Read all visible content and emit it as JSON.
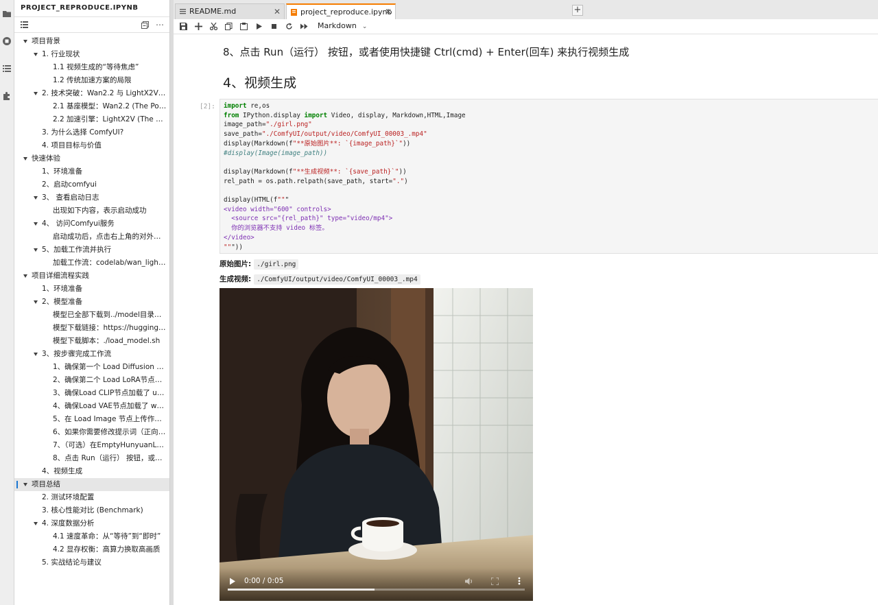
{
  "sidebar": {
    "title": "PROJECT_REPRODUCE.IPYNB",
    "items": [
      {
        "level": 1,
        "label": "项目背景",
        "expanded": true
      },
      {
        "level": 2,
        "label": "1. 行业现状",
        "expanded": true
      },
      {
        "level": 3,
        "label": "1.1 视频生成的“等待焦虑”"
      },
      {
        "level": 3,
        "label": "1.2 传统加速方案的局限"
      },
      {
        "level": 2,
        "label": "2. 技术突破：Wan2.2 与 LightX2V 的...",
        "expanded": true
      },
      {
        "level": 3,
        "label": "2.1 基座模型：Wan2.2 (The Power..."
      },
      {
        "level": 3,
        "label": "2.2 加速引擎：LightX2V (The Spe..."
      },
      {
        "level": 2,
        "label": "3. 为什么选择 ComfyUI?"
      },
      {
        "level": 2,
        "label": "4. 项目目标与价值"
      },
      {
        "level": 1,
        "label": "快速体验",
        "expanded": true
      },
      {
        "level": 2,
        "label": "1、环境准备"
      },
      {
        "level": 2,
        "label": "2、启动comfyui"
      },
      {
        "level": 2,
        "label": "3、 查看启动日志",
        "expanded": true
      },
      {
        "level": 3,
        "label": "出现如下内容，表示启动成功"
      },
      {
        "level": 2,
        "label": "4、 访问Comfyui服务",
        "expanded": true
      },
      {
        "level": 3,
        "label": "启动成功后，点击右上角的对外服务..."
      },
      {
        "level": 2,
        "label": "5、加载工作流并执行",
        "expanded": true
      },
      {
        "level": 3,
        "label": "加载工作流：codelab/wan_lightx2..."
      },
      {
        "level": 1,
        "label": "项目详细流程实践",
        "expanded": true
      },
      {
        "level": 2,
        "label": "1、环境准备"
      },
      {
        "level": 2,
        "label": "2、模型准备",
        "expanded": true
      },
      {
        "level": 3,
        "label": "模型已全部下载到../model目录下，..."
      },
      {
        "level": 3,
        "label": "模型下载链接：https://huggingfac..."
      },
      {
        "level": 3,
        "label": "模型下载脚本：./load_model.sh"
      },
      {
        "level": 2,
        "label": "3、按步骤完成工作流",
        "expanded": true
      },
      {
        "level": 3,
        "label": "1、确保第一个 Load Diffusion Mo..."
      },
      {
        "level": 3,
        "label": "2、确保第二个 Load LoRA节点加载..."
      },
      {
        "level": 3,
        "label": "3、确保Load CLIP节点加载了 umt..."
      },
      {
        "level": 3,
        "label": "4、确保Load VAE节点加载了 wan_..."
      },
      {
        "level": 3,
        "label": "5、在 Load Image 节点上传作为起..."
      },
      {
        "level": 3,
        "label": "6、如果你需要修改提示词（正向及..."
      },
      {
        "level": 3,
        "label": "7、（可选）在EmptyHunyuanLate..."
      },
      {
        "level": 3,
        "label": "8、点击 Run（运行） 按钮，或者..."
      },
      {
        "level": 2,
        "label": "4、视频生成"
      },
      {
        "level": 1,
        "label": "项目总结",
        "expanded": true,
        "active": true
      },
      {
        "level": 2,
        "label": "2. 测试环境配置"
      },
      {
        "level": 2,
        "label": "3. 核心性能对比 (Benchmark)"
      },
      {
        "level": 2,
        "label": "4. 深度数据分析",
        "expanded": true
      },
      {
        "level": 3,
        "label": "4.1 速度革命：从“等待”到“即时”"
      },
      {
        "level": 3,
        "label": "4.2 显存权衡：高算力换取高画质"
      },
      {
        "level": 2,
        "label": "5. 实战结论与建议"
      }
    ]
  },
  "tabs": [
    {
      "label": "README.md",
      "icon": "markdown-file-icon"
    },
    {
      "label": "project_reproduce.ipynb",
      "icon": "notebook-file-icon",
      "active": true
    }
  ],
  "toolbar": {
    "cell_type": "Markdown",
    "icons": [
      "save-icon",
      "add-cell-icon",
      "cut-icon",
      "copy-icon",
      "paste-icon",
      "run-icon",
      "stop-icon",
      "restart-icon",
      "run-all-icon"
    ]
  },
  "notebook": {
    "md_step": "8、点击 Run（运行） 按钮，或者使用快捷键 Ctrl(cmd) + Enter(回车) 来执行视频生成",
    "heading": "4、视频生成",
    "prompt": "[2]:",
    "code_lines": [
      "import re,os",
      "from IPython.display import Video, display, Markdown,HTML,Image",
      "image_path=\"./girl.png\"",
      "save_path=\"./ComfyUI/output/video/ComfyUI_00003_.mp4\"",
      "display(Markdown(f\"**原始图片**: `{image_path}`\"))",
      "#display(Image(image_path))",
      "",
      "display(Markdown(f\"**生成视频**: `{save_path}`\"))",
      "rel_path = os.path.relpath(save_path, start=\".\")",
      "",
      "display(HTML(f\"\"\"",
      "<video width=\"600\" controls>",
      "  <source src=\"{rel_path}\" type=\"video/mp4\">",
      "  你的浏览器不支持 video 标签。",
      "</video>",
      "\"\"\"))"
    ],
    "output": {
      "orig_label": "原始图片:",
      "orig_value": "./girl.png",
      "gen_label": "生成视频:",
      "gen_value": "./ComfyUI/output/video/ComfyUI_00003_.mp4"
    },
    "video": {
      "time": "0:00 / 0:05",
      "progress": 0.495
    }
  }
}
